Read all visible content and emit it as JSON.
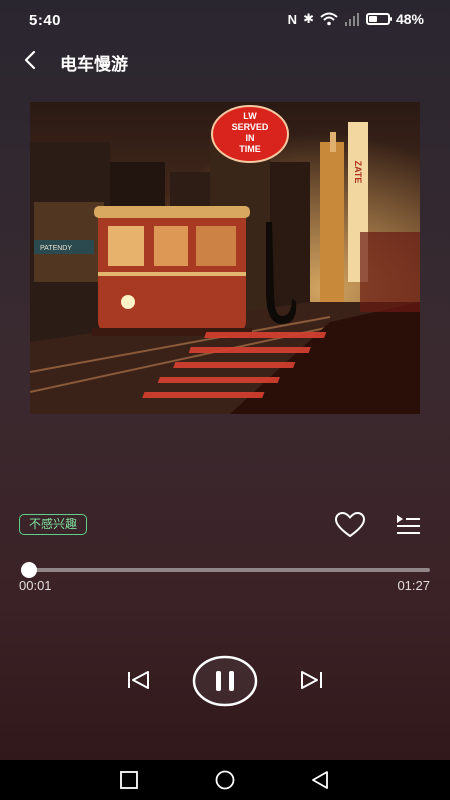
{
  "status_bar": {
    "time": "5:40",
    "nfc_icon": "N",
    "bluetooth_icon": "✱",
    "battery_percent": "48%",
    "battery_level": 0.48
  },
  "header": {
    "title": "电车慢游"
  },
  "cover": {
    "neon_sign_text": [
      "LW",
      "SERVED",
      "IN",
      "TIME"
    ],
    "tower_sign_text": "ZATE",
    "storefront_text": "PATENDY"
  },
  "actions": {
    "not_interested_label": "不感兴趣"
  },
  "playback": {
    "current_time": "00:01",
    "total_time": "01:27",
    "progress": 0.0115
  },
  "colors": {
    "accent_green": "#5fd08a",
    "background_top": "#2a2630",
    "background_bottom": "#2e1618"
  }
}
